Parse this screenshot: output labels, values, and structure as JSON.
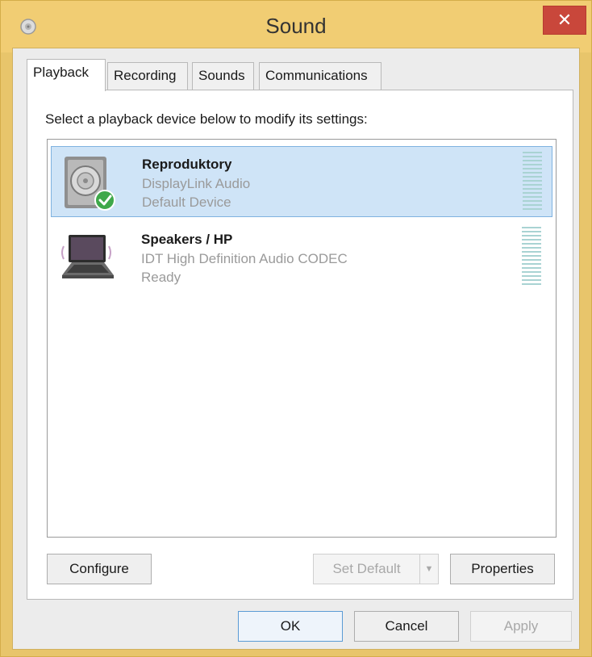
{
  "window": {
    "title": "Sound",
    "close_label": "✕",
    "accent_color": "#f1cd73",
    "close_color": "#c9473b"
  },
  "tabs": [
    {
      "label": "Playback",
      "active": true
    },
    {
      "label": "Recording",
      "active": false
    },
    {
      "label": "Sounds",
      "active": false
    },
    {
      "label": "Communications",
      "active": false
    }
  ],
  "playback": {
    "instruction": "Select a playback device below to modify its settings:",
    "devices": [
      {
        "name": "Reproduktory",
        "driver": "DisplayLink Audio",
        "status": "Default Device",
        "icon": "speaker-icon",
        "badge": "default-check-icon",
        "selected": true
      },
      {
        "name": "Speakers / HP",
        "driver": "IDT High Definition Audio CODEC",
        "status": "Ready",
        "icon": "laptop-speaker-icon",
        "selected": false
      }
    ],
    "buttons": {
      "configure": "Configure",
      "set_default": "Set Default",
      "set_default_arrow": "▼",
      "properties": "Properties"
    }
  },
  "dialog_buttons": {
    "ok": "OK",
    "cancel": "Cancel",
    "apply": "Apply"
  }
}
